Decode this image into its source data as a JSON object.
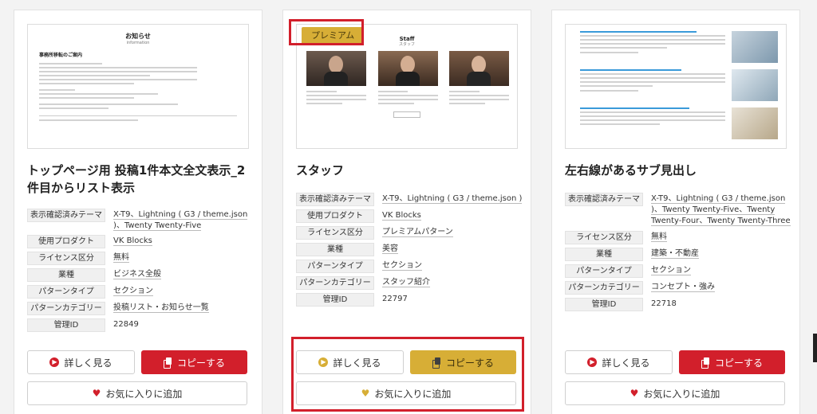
{
  "cards": [
    {
      "title": "トップページ用 投稿1件本文全文表示_2件目からリスト表示",
      "thumb": {
        "heading": "お知らせ",
        "subheading": "information",
        "post_title": "事務所移転のご案内"
      },
      "meta": [
        {
          "key": "表示確認済みテーマ",
          "value": "X-T9、Lightning ( G3 / theme.json )、Twenty Twenty-Five"
        },
        {
          "key": "使用プロダクト",
          "value": "VK Blocks"
        },
        {
          "key": "ライセンス区分",
          "value": "無料"
        },
        {
          "key": "業種",
          "value": "ビジネス全般"
        },
        {
          "key": "パターンタイプ",
          "value": "セクション"
        },
        {
          "key": "パターンカテゴリー",
          "value": "投稿リスト・お知らせ一覧"
        },
        {
          "key": "管理ID",
          "value": "22849"
        }
      ],
      "detail_label": "詳しく見る",
      "copy_label": "コピーする",
      "fav_label": "お気に入りに追加"
    },
    {
      "title": "スタッフ",
      "badge": "プレミアム",
      "thumb": {
        "heading": "Staff",
        "subheading": "スタッフ"
      },
      "meta": [
        {
          "key": "表示確認済みテーマ",
          "value": "X-T9、Lightning ( G3 / theme.json )"
        },
        {
          "key": "使用プロダクト",
          "value": "VK Blocks"
        },
        {
          "key": "ライセンス区分",
          "value": "プレミアムパターン"
        },
        {
          "key": "業種",
          "value": "美容"
        },
        {
          "key": "パターンタイプ",
          "value": "セクション"
        },
        {
          "key": "パターンカテゴリー",
          "value": "スタッフ紹介"
        },
        {
          "key": "管理ID",
          "value": "22797"
        }
      ],
      "detail_label": "詳しく見る",
      "copy_label": "コピーする",
      "fav_label": "お気に入りに追加"
    },
    {
      "title": "左右線があるサブ見出し",
      "meta": [
        {
          "key": "表示確認済みテーマ",
          "value": "X-T9、Lightning ( G3 / theme.json )、Twenty Twenty-Five、Twenty Twenty-Four、Twenty Twenty-Three"
        },
        {
          "key": "ライセンス区分",
          "value": "無料"
        },
        {
          "key": "業種",
          "value": "建築・不動産"
        },
        {
          "key": "パターンタイプ",
          "value": "セクション"
        },
        {
          "key": "パターンカテゴリー",
          "value": "コンセプト・強み"
        },
        {
          "key": "管理ID",
          "value": "22718"
        }
      ],
      "detail_label": "詳しく見る",
      "copy_label": "コピーする",
      "fav_label": "お気に入りに追加"
    }
  ],
  "colors": {
    "red": "#d21f2b",
    "gold": "#d7ae36",
    "detail_icon_red": "#d21f2b",
    "detail_icon_gold": "#d7ae36",
    "heart_red": "#d21f2b",
    "heart_gold": "#d7ae36"
  },
  "icons": {
    "detail": "arrow-right-circle-icon",
    "copy": "copy-icon",
    "fav": "heart-icon"
  }
}
